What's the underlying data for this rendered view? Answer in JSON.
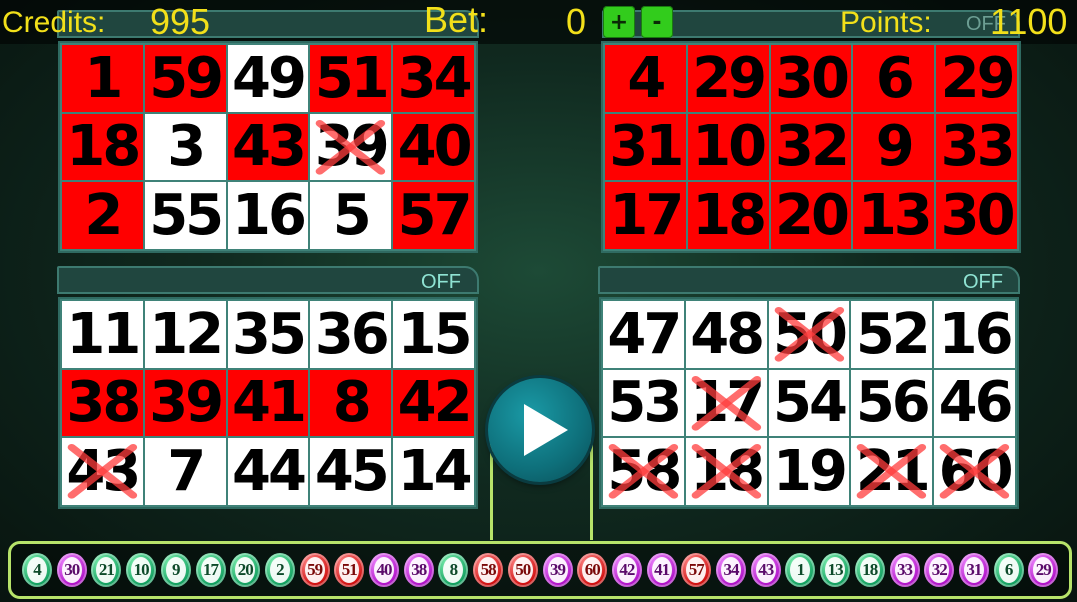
{
  "hud": {
    "credits_label": "Credits:",
    "credits_value": "995",
    "bet_label": "Bet:",
    "bet_value": "0",
    "plus_label": "+",
    "minus_label": "-",
    "points_label": "Points:",
    "points_value": "1100"
  },
  "cards": [
    {
      "name": "card-top-left",
      "off_label": "",
      "cells": [
        {
          "n": "1",
          "c": "red",
          "x": false
        },
        {
          "n": "59",
          "c": "red",
          "x": false
        },
        {
          "n": "49",
          "c": "white",
          "x": false
        },
        {
          "n": "51",
          "c": "red",
          "x": false
        },
        {
          "n": "34",
          "c": "red",
          "x": false
        },
        {
          "n": "18",
          "c": "red",
          "x": false
        },
        {
          "n": "3",
          "c": "white",
          "x": false
        },
        {
          "n": "43",
          "c": "red",
          "x": false
        },
        {
          "n": "39",
          "c": "white",
          "x": true
        },
        {
          "n": "40",
          "c": "red",
          "x": false
        },
        {
          "n": "2",
          "c": "red",
          "x": false
        },
        {
          "n": "55",
          "c": "white",
          "x": false
        },
        {
          "n": "16",
          "c": "white",
          "x": false
        },
        {
          "n": "5",
          "c": "white",
          "x": false
        },
        {
          "n": "57",
          "c": "red",
          "x": false
        }
      ]
    },
    {
      "name": "card-top-right",
      "off_label": "OFF",
      "cells": [
        {
          "n": "4",
          "c": "red",
          "x": false
        },
        {
          "n": "29",
          "c": "red",
          "x": false
        },
        {
          "n": "30",
          "c": "red",
          "x": false
        },
        {
          "n": "6",
          "c": "red",
          "x": false
        },
        {
          "n": "29",
          "c": "red",
          "x": false
        },
        {
          "n": "31",
          "c": "red",
          "x": false
        },
        {
          "n": "10",
          "c": "red",
          "x": false
        },
        {
          "n": "32",
          "c": "red",
          "x": false
        },
        {
          "n": "9",
          "c": "red",
          "x": false
        },
        {
          "n": "33",
          "c": "red",
          "x": false
        },
        {
          "n": "17",
          "c": "red",
          "x": false
        },
        {
          "n": "18",
          "c": "red",
          "x": false
        },
        {
          "n": "20",
          "c": "red",
          "x": false
        },
        {
          "n": "13",
          "c": "red",
          "x": false
        },
        {
          "n": "30",
          "c": "red",
          "x": false
        }
      ]
    },
    {
      "name": "card-bottom-left",
      "off_label": "OFF",
      "cells": [
        {
          "n": "11",
          "c": "white",
          "x": false
        },
        {
          "n": "12",
          "c": "white",
          "x": false
        },
        {
          "n": "35",
          "c": "white",
          "x": false
        },
        {
          "n": "36",
          "c": "white",
          "x": false
        },
        {
          "n": "15",
          "c": "white",
          "x": false
        },
        {
          "n": "38",
          "c": "red",
          "x": false
        },
        {
          "n": "39",
          "c": "red",
          "x": false
        },
        {
          "n": "41",
          "c": "red",
          "x": false
        },
        {
          "n": "8",
          "c": "red",
          "x": false
        },
        {
          "n": "42",
          "c": "red",
          "x": false
        },
        {
          "n": "43",
          "c": "white",
          "x": true
        },
        {
          "n": "7",
          "c": "white",
          "x": false
        },
        {
          "n": "44",
          "c": "white",
          "x": false
        },
        {
          "n": "45",
          "c": "white",
          "x": false
        },
        {
          "n": "14",
          "c": "white",
          "x": false
        }
      ]
    },
    {
      "name": "card-bottom-right",
      "off_label": "OFF",
      "cells": [
        {
          "n": "47",
          "c": "white",
          "x": false
        },
        {
          "n": "48",
          "c": "white",
          "x": false
        },
        {
          "n": "50",
          "c": "white",
          "x": true
        },
        {
          "n": "52",
          "c": "white",
          "x": false
        },
        {
          "n": "16",
          "c": "white",
          "x": false
        },
        {
          "n": "53",
          "c": "white",
          "x": false
        },
        {
          "n": "17",
          "c": "white",
          "x": true
        },
        {
          "n": "54",
          "c": "white",
          "x": false
        },
        {
          "n": "56",
          "c": "white",
          "x": false
        },
        {
          "n": "46",
          "c": "white",
          "x": false
        },
        {
          "n": "58",
          "c": "white",
          "x": true
        },
        {
          "n": "18",
          "c": "white",
          "x": true
        },
        {
          "n": "19",
          "c": "white",
          "x": false
        },
        {
          "n": "21",
          "c": "white",
          "x": true
        },
        {
          "n": "60",
          "c": "white",
          "x": true
        }
      ]
    }
  ],
  "drawn_balls": [
    {
      "n": "4",
      "c": "green"
    },
    {
      "n": "30",
      "c": "purple"
    },
    {
      "n": "21",
      "c": "green"
    },
    {
      "n": "10",
      "c": "green"
    },
    {
      "n": "9",
      "c": "green"
    },
    {
      "n": "17",
      "c": "green"
    },
    {
      "n": "20",
      "c": "green"
    },
    {
      "n": "2",
      "c": "green"
    },
    {
      "n": "59",
      "c": "red"
    },
    {
      "n": "51",
      "c": "red"
    },
    {
      "n": "40",
      "c": "purple"
    },
    {
      "n": "38",
      "c": "purple"
    },
    {
      "n": "8",
      "c": "green"
    },
    {
      "n": "58",
      "c": "red"
    },
    {
      "n": "50",
      "c": "red"
    },
    {
      "n": "39",
      "c": "purple"
    },
    {
      "n": "60",
      "c": "red"
    },
    {
      "n": "42",
      "c": "purple"
    },
    {
      "n": "41",
      "c": "purple"
    },
    {
      "n": "57",
      "c": "red"
    },
    {
      "n": "34",
      "c": "purple"
    },
    {
      "n": "43",
      "c": "purple"
    },
    {
      "n": "1",
      "c": "green"
    },
    {
      "n": "13",
      "c": "green"
    },
    {
      "n": "18",
      "c": "green"
    },
    {
      "n": "33",
      "c": "purple"
    },
    {
      "n": "32",
      "c": "purple"
    },
    {
      "n": "31",
      "c": "purple"
    },
    {
      "n": "6",
      "c": "green"
    },
    {
      "n": "29",
      "c": "purple"
    }
  ],
  "icons": {
    "play": "play-icon",
    "cross_mark": "cross-mark-icon"
  }
}
